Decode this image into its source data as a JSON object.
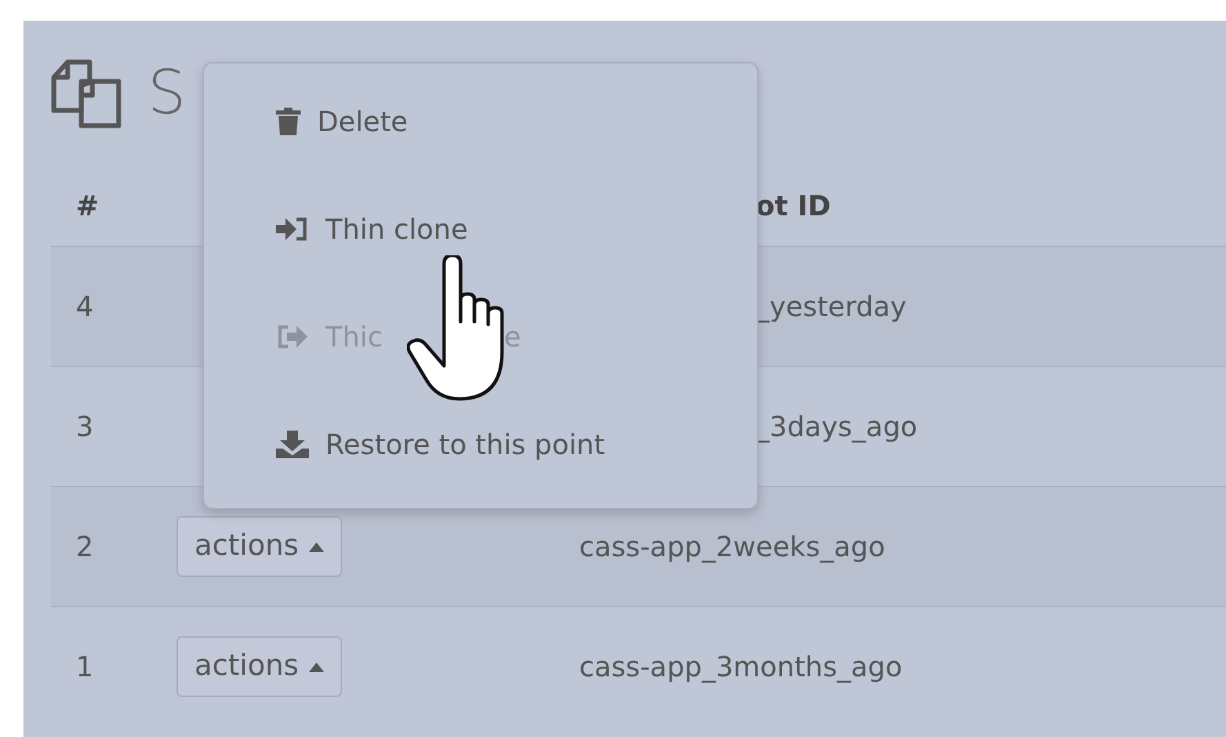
{
  "title": "S",
  "menu": [
    {
      "label": "Delete",
      "disabled": false
    },
    {
      "label": "Thin clone",
      "disabled": false
    },
    {
      "label": "Thic",
      "label_end": "e",
      "disabled": true
    },
    {
      "label": "Restore to this point",
      "disabled": false
    }
  ],
  "columns": [
    {
      "label": "#"
    },
    {
      "label": "ot ID",
      "clipped": true
    }
  ],
  "rows": [
    {
      "number": "4",
      "snapshot_id": "_yesterday",
      "clipped": true
    },
    {
      "number": "3",
      "snapshot_id": "_3days_ago",
      "clipped": true
    },
    {
      "number": "2",
      "action": "actions",
      "snapshot_id": "cass-app_2weeks_ago"
    },
    {
      "number": "1",
      "action": "actions",
      "snapshot_id": "cass-app_3months_ago"
    }
  ]
}
